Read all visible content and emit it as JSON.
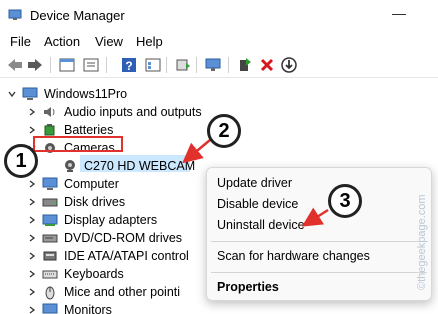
{
  "window": {
    "title": "Device Manager"
  },
  "menu": [
    "File",
    "Action",
    "View",
    "Help"
  ],
  "toolbar": {
    "icons": [
      "back-arrow-icon",
      "forward-arrow-icon",
      "properties-icon",
      "list-icon",
      "help-icon",
      "details-icon",
      "update-driver-icon",
      "scan-hardware-icon",
      "enable-device-icon",
      "uninstall-x-icon",
      "download-icon"
    ]
  },
  "tree": {
    "root": "Windows11Pro",
    "items": [
      {
        "label": "Audio inputs and outputs",
        "icon": "speaker-icon"
      },
      {
        "label": "Batteries",
        "icon": "battery-icon"
      },
      {
        "label": "Cameras",
        "icon": "camera-icon",
        "expanded": true
      },
      {
        "label": "C270 HD WEBCAM",
        "icon": "webcam-icon",
        "child": true,
        "selected": true
      },
      {
        "label": "Computer",
        "icon": "monitor-icon"
      },
      {
        "label": "Disk drives",
        "icon": "disk-icon"
      },
      {
        "label": "Display adapters",
        "icon": "display-adapter-icon"
      },
      {
        "label": "DVD/CD-ROM drives",
        "icon": "dvd-icon"
      },
      {
        "label": "IDE ATA/ATAPI control",
        "icon": "ide-icon"
      },
      {
        "label": "Keyboards",
        "icon": "keyboard-icon"
      },
      {
        "label": "Mice and other pointi",
        "icon": "mouse-icon"
      },
      {
        "label": "Monitors",
        "icon": "monitor-icon"
      }
    ]
  },
  "context_menu": {
    "items": [
      "Update driver",
      "Disable device",
      "Uninstall device",
      "Scan for hardware changes",
      "Properties"
    ]
  },
  "callouts": [
    "1",
    "2",
    "3"
  ],
  "watermark": "©thegeekpage.com",
  "colors": {
    "selection": "#cce8ff",
    "annotation_red": "#e0312d"
  }
}
